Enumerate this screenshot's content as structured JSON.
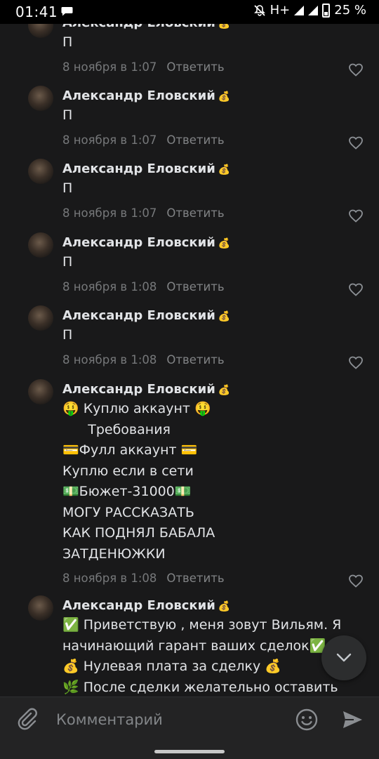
{
  "status_bar": {
    "time": "01:41",
    "network": "H+",
    "battery": "25 %"
  },
  "comments": [
    {
      "author": "Александр Еловский",
      "badge": "💰",
      "lines": [
        "П"
      ],
      "date": "8 ноября в 1:07",
      "reply": "Ответить"
    },
    {
      "author": "Александр Еловский",
      "badge": "💰",
      "lines": [
        "П"
      ],
      "date": "8 ноября в 1:07",
      "reply": "Ответить"
    },
    {
      "author": "Александр Еловский",
      "badge": "💰",
      "lines": [
        "П"
      ],
      "date": "8 ноября в 1:07",
      "reply": "Ответить"
    },
    {
      "author": "Александр Еловский",
      "badge": "💰",
      "lines": [
        "П"
      ],
      "date": "8 ноября в 1:08",
      "reply": "Ответить"
    },
    {
      "author": "Александр Еловский",
      "badge": "💰",
      "lines": [
        "П"
      ],
      "date": "8 ноября в 1:08",
      "reply": "Ответить"
    },
    {
      "author": "Александр Еловский",
      "badge": "💰",
      "lines": [
        "🤑 Куплю аккаунт 🤑",
        "      Требования",
        "💳Фулл аккаунт 💳",
        "Куплю если в сети",
        "💵Бюжет-31000💵",
        "МОГУ РАССКАЗАТЬ",
        "КАК ПОДНЯЛ БАБАЛА",
        "ЗАТДЕНЮЖКИ"
      ],
      "date": "8 ноября в 1:08",
      "reply": "Ответить"
    },
    {
      "author": "Александр Еловский",
      "badge": "💰",
      "lines": [
        "✅ Приветствую , меня зовут Вильям. Я",
        "начинающий гарант ваших сделок✅",
        "💰 Нулевая плата за сделку 💰",
        "🌿 После сделки желательно оставить"
      ],
      "date": "",
      "reply": ""
    }
  ],
  "composer": {
    "placeholder": "Комментарий"
  },
  "icons": {
    "like": "heart-outline-icon",
    "attach": "paperclip-icon",
    "emoji": "smile-icon",
    "send": "send-arrow-icon",
    "scroll_down": "chevron-down-icon"
  }
}
